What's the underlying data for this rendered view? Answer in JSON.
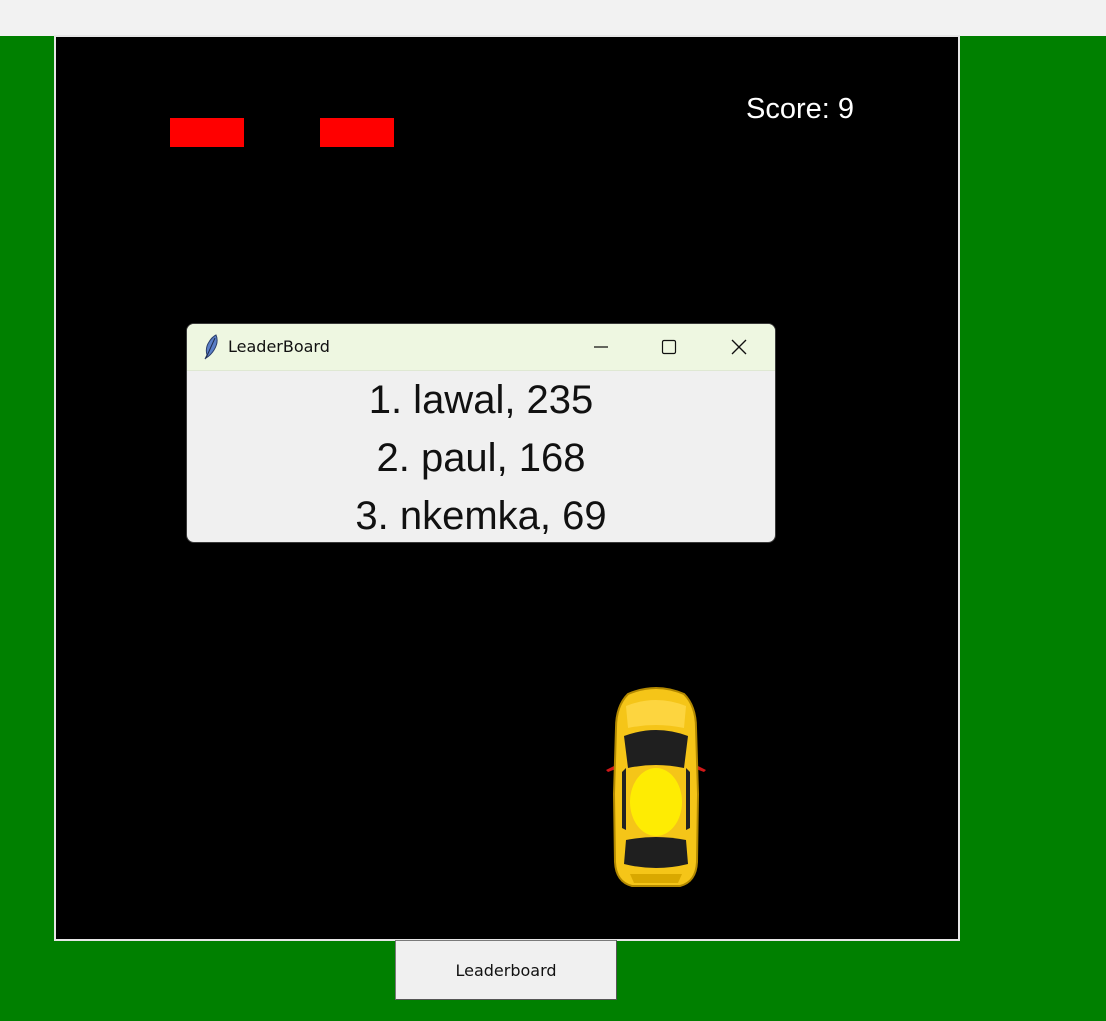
{
  "game": {
    "score_text": "Score: 9",
    "colors": {
      "background": "#008000",
      "canvas": "#000000",
      "obstacle": "#ff0000",
      "car": "#f5d020"
    },
    "icons": {
      "player": "yellow-car-icon",
      "obstacle": "red-block"
    }
  },
  "leaderboard_window": {
    "title": "LeaderBoard",
    "app_icon": "feather-icon",
    "controls": {
      "minimize": "minimize-icon",
      "maximize": "maximize-icon",
      "close": "close-icon"
    },
    "entries": [
      "1. lawal, 235",
      "2. paul, 168",
      "3. nkemka, 69"
    ]
  },
  "controls": {
    "leaderboard_button": "Leaderboard"
  }
}
